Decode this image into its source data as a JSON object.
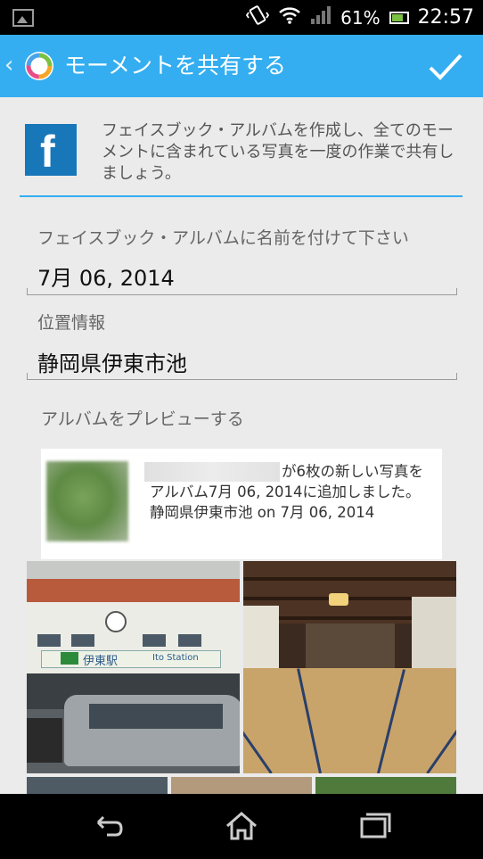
{
  "status_bar": {
    "battery_percent": "61%",
    "time": "22:57",
    "icons": [
      "image-notification-icon",
      "vibrate-icon",
      "wifi-icon",
      "signal-icon",
      "battery-icon"
    ]
  },
  "action_bar": {
    "title": "モーメントを共有する",
    "accent_color": "#34aef0"
  },
  "facebook_info": {
    "description": "フェイスブック・アルバムを作成し、全てのモーメントに含まれている写真を一度の作業で共有しましょう。",
    "logo_letter": "f"
  },
  "album_name": {
    "label": "フェイスブック・アルバムに名前を付けて下さい",
    "value": "7月 06, 2014"
  },
  "location": {
    "label": "位置情報",
    "value": "静岡県伊東市池"
  },
  "preview": {
    "label": "アルバムをプレビューする",
    "post_text": "が6枚の新しい写真をアルバム7月 06, 2014に追加しました。静岡県伊東市池 on 7月 06, 2014"
  },
  "photos": [
    {
      "name": "station-photo",
      "station_sign": "伊東駅",
      "station_sign_en": "Ito Station"
    },
    {
      "name": "tatami-hall-photo"
    },
    {
      "name": "photo-3"
    },
    {
      "name": "photo-4"
    },
    {
      "name": "photo-5"
    }
  ]
}
